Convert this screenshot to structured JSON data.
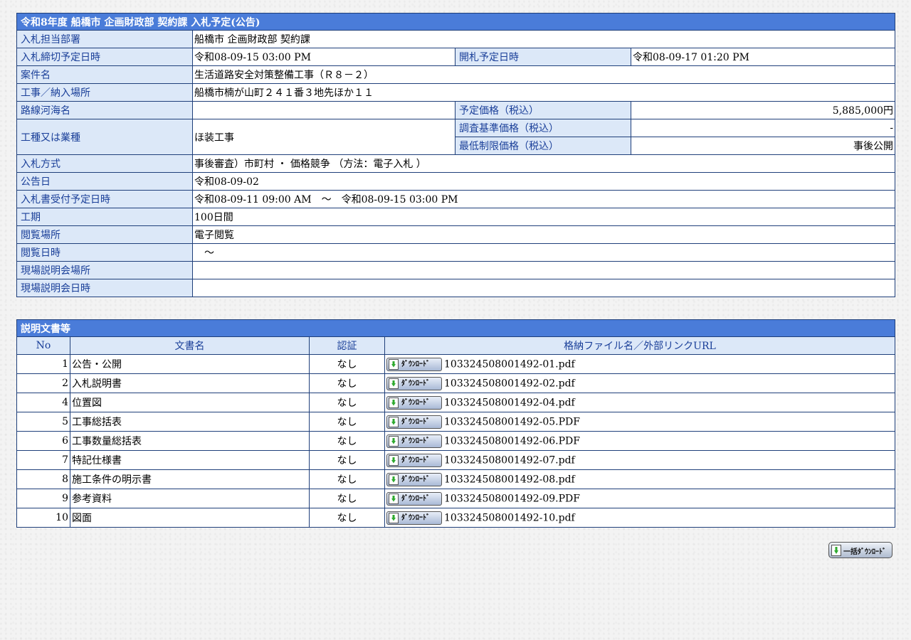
{
  "main": {
    "title": "令和8年度 船橋市 企画財政部 契約課 入札予定(公告)",
    "dept_label": "入札担当部署",
    "dept_value": "船橋市 企画財政部 契約課",
    "deadline_label": "入札締切予定日時",
    "deadline_value": "令和08-09-15 03:00 PM",
    "opening_label": "開札予定日時",
    "opening_value": "令和08-09-17 01:20 PM",
    "case_label": "案件名",
    "case_value": "生活道路安全対策整備工事（Ｒ８－２）",
    "place_label": "工事／納入場所",
    "place_value": "船橋市楠が山町２４１番３地先ほか１１",
    "route_label": "路線河海名",
    "route_value": "",
    "planned_price_label": "予定価格（税込）",
    "planned_price_value": "5,885,000円",
    "category_label": "工種又は業種",
    "category_value": "ほ装工事",
    "survey_price_label": "調査基準価格（税込）",
    "survey_price_value": "-",
    "min_price_label": "最低制限価格（税込）",
    "min_price_value": "事後公開",
    "method_label": "入札方式",
    "method_value": "事後審査）市町村 ・ 価格競争 （方法：電子入札 ）",
    "notice_date_label": "公告日",
    "notice_date_value": "令和08-09-02",
    "receipt_label": "入札書受付予定日時",
    "receipt_value": "令和08-09-11 09:00 AM　～　令和08-09-15 03:00 PM",
    "period_label": "工期",
    "period_value": "100日間",
    "viewing_place_label": "閲覧場所",
    "viewing_place_value": "電子閲覧",
    "viewing_date_label": "閲覧日時",
    "viewing_date_value": "　～",
    "site_place_label": "現場説明会場所",
    "site_place_value": "",
    "site_date_label": "現場説明会日時",
    "site_date_value": ""
  },
  "docs": {
    "title": "説明文書等",
    "col_no": "No",
    "col_name": "文書名",
    "col_auth": "認証",
    "col_file": "格納ファイル名／外部リンクURL",
    "download_label": "ﾀﾞｳﾝﾛｰﾄﾞ",
    "rows": [
      {
        "no": "1",
        "name": "公告・公開",
        "auth": "なし",
        "file": "103324508001492-01.pdf"
      },
      {
        "no": "2",
        "name": "入札説明書",
        "auth": "なし",
        "file": "103324508001492-02.pdf"
      },
      {
        "no": "4",
        "name": "位置図",
        "auth": "なし",
        "file": "103324508001492-04.pdf"
      },
      {
        "no": "5",
        "name": "工事総括表",
        "auth": "なし",
        "file": "103324508001492-05.PDF"
      },
      {
        "no": "6",
        "name": "工事数量総括表",
        "auth": "なし",
        "file": "103324508001492-06.PDF"
      },
      {
        "no": "7",
        "name": "特記仕様書",
        "auth": "なし",
        "file": "103324508001492-07.pdf"
      },
      {
        "no": "8",
        "name": "施工条件の明示書",
        "auth": "なし",
        "file": "103324508001492-08.pdf"
      },
      {
        "no": "9",
        "name": "参考資料",
        "auth": "なし",
        "file": "103324508001492-09.PDF"
      },
      {
        "no": "10",
        "name": "図面",
        "auth": "なし",
        "file": "103324508001492-10.pdf"
      }
    ],
    "bulk_label": "一括ﾀﾞｳﾝﾛｰﾄﾞ"
  }
}
